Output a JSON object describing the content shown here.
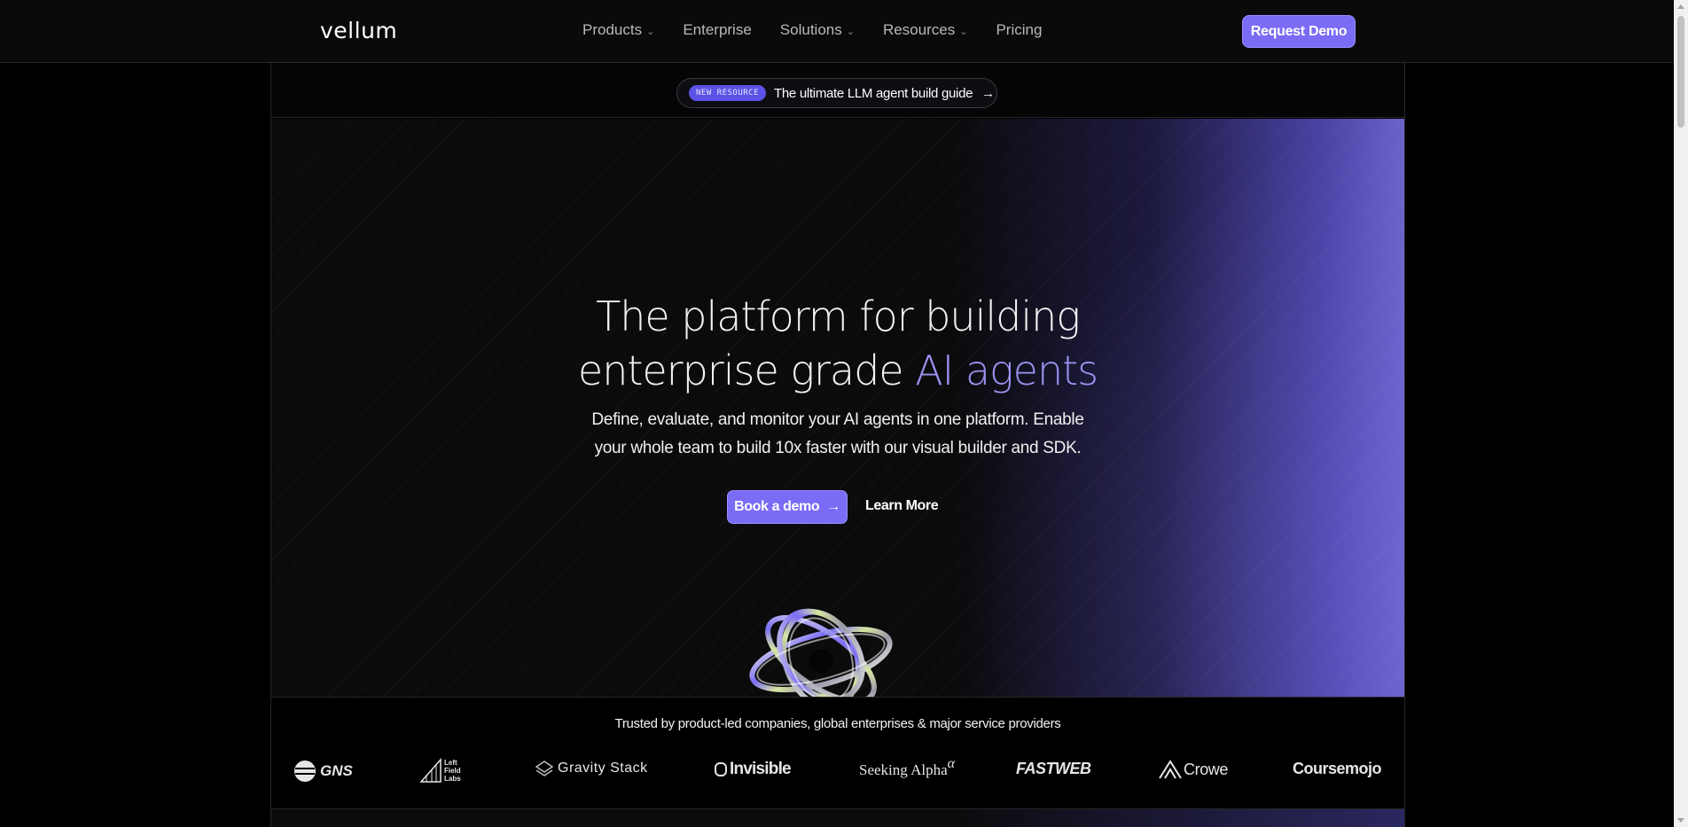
{
  "nav": {
    "logo": "vellum",
    "items": [
      {
        "label": "Products",
        "dropdown": true
      },
      {
        "label": "Enterprise",
        "dropdown": false
      },
      {
        "label": "Solutions",
        "dropdown": true
      },
      {
        "label": "Resources",
        "dropdown": true
      },
      {
        "label": "Pricing",
        "dropdown": false
      }
    ],
    "cta": "Request Demo"
  },
  "banner": {
    "badge": "NEW RESOURCE",
    "text": "The ultimate LLM agent build guide",
    "arrow": "→"
  },
  "hero": {
    "headline_line1": "The platform for building",
    "headline_line2_plain": "enterprise grade ",
    "headline_line2_accent": "AI agents",
    "subtext_line1": "Define, evaluate, and monitor your AI agents in one platform. Enable",
    "subtext_line2": "your whole team to build 10x faster with our visual builder and SDK.",
    "primary_cta": "Book a demo",
    "primary_cta_arrow": "→",
    "secondary_cta": "Learn More"
  },
  "trusted": {
    "text": "Trusted by product-led companies, global enterprises & major service providers",
    "logos": {
      "gns": "GNS",
      "leftfield_1": "Left",
      "leftfield_2": "Field",
      "leftfield_3": "Labs",
      "gravity": "Gravity Stack",
      "invisible": "Invisible",
      "seeking": "Seeking Alpha",
      "seeking_sup": "α",
      "fastweb": "FASTWEB",
      "crowe": "Crowe",
      "coursemojo": "Coursemojo"
    }
  },
  "colors": {
    "accent": "#7a6cf5",
    "accent_text": "#9b93f2",
    "background": "#000000"
  }
}
